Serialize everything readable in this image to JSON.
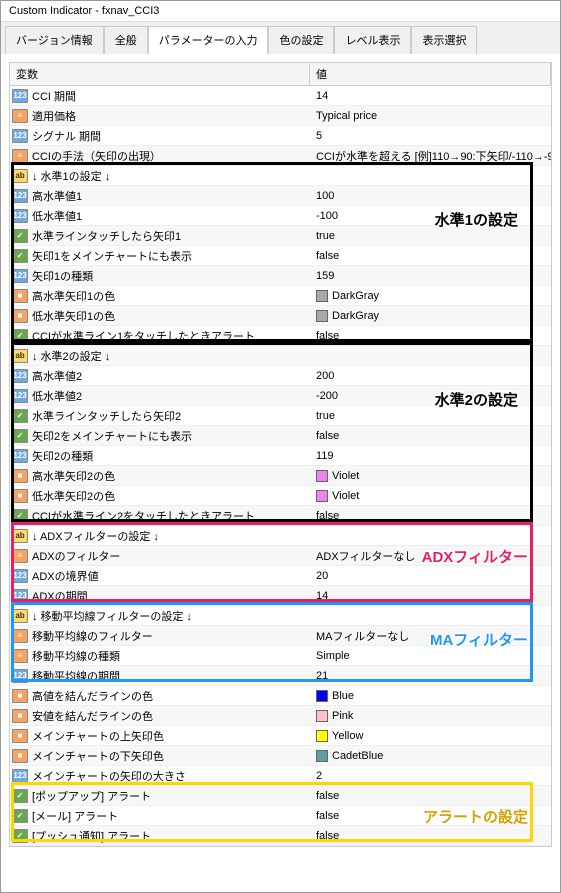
{
  "window": {
    "title": "Custom Indicator - fxnav_CCI3"
  },
  "tabs": {
    "version": "バージョン情報",
    "general": "全般",
    "params": "パラメーターの入力",
    "colors": "色の設定",
    "levels": "レベル表示",
    "display": "表示選択"
  },
  "headers": {
    "variable": "変数",
    "value": "値"
  },
  "rows": [
    {
      "icon": "int",
      "name": "CCI 期間",
      "val": "14"
    },
    {
      "icon": "enum",
      "name": "適用価格",
      "val": "Typical price"
    },
    {
      "icon": "int",
      "name": "シグナル 期間",
      "val": "5"
    },
    {
      "icon": "enum",
      "name": "CCIの手法（矢印の出現）",
      "val": "CCIが水準を超える [例]110→90:下矢印/-110→-9…"
    },
    {
      "icon": "str",
      "name": "↓ 水準1の設定 ↓",
      "val": ""
    },
    {
      "icon": "int",
      "name": "高水準値1",
      "val": "100"
    },
    {
      "icon": "int",
      "name": "低水準値1",
      "val": "-100"
    },
    {
      "icon": "bool",
      "name": "水準ラインタッチしたら矢印1",
      "val": "true"
    },
    {
      "icon": "bool",
      "name": "矢印1をメインチャートにも表示",
      "val": "false"
    },
    {
      "icon": "int",
      "name": "矢印1の種類",
      "val": "159"
    },
    {
      "icon": "color",
      "name": "高水準矢印1の色",
      "val": "DarkGray",
      "swatch": "#a9a9a9"
    },
    {
      "icon": "color",
      "name": "低水準矢印1の色",
      "val": "DarkGray",
      "swatch": "#a9a9a9"
    },
    {
      "icon": "bool",
      "name": "CCIが水準ライン1をタッチしたときアラート",
      "val": "false"
    },
    {
      "icon": "str",
      "name": "↓ 水準2の設定 ↓",
      "val": ""
    },
    {
      "icon": "int",
      "name": "高水準値2",
      "val": "200"
    },
    {
      "icon": "int",
      "name": "低水準値2",
      "val": "-200"
    },
    {
      "icon": "bool",
      "name": "水準ラインタッチしたら矢印2",
      "val": "true"
    },
    {
      "icon": "bool",
      "name": "矢印2をメインチャートにも表示",
      "val": "false"
    },
    {
      "icon": "int",
      "name": "矢印2の種類",
      "val": "119"
    },
    {
      "icon": "color",
      "name": "高水準矢印2の色",
      "val": "Violet",
      "swatch": "#ee82ee"
    },
    {
      "icon": "color",
      "name": "低水準矢印2の色",
      "val": "Violet",
      "swatch": "#ee82ee"
    },
    {
      "icon": "bool",
      "name": "CCIが水準ライン2をタッチしたときアラート",
      "val": "false"
    },
    {
      "icon": "str",
      "name": "↓ ADXフィルターの設定 ↓",
      "val": ""
    },
    {
      "icon": "enum",
      "name": "ADXのフィルター",
      "val": "ADXフィルターなし"
    },
    {
      "icon": "int",
      "name": "ADXの境界値",
      "val": "20"
    },
    {
      "icon": "int",
      "name": "ADXの期間",
      "val": "14"
    },
    {
      "icon": "str",
      "name": "↓ 移動平均線フィルターの設定 ↓",
      "val": ""
    },
    {
      "icon": "enum",
      "name": "移動平均線のフィルター",
      "val": "MAフィルターなし"
    },
    {
      "icon": "enum",
      "name": "移動平均線の種類",
      "val": "Simple"
    },
    {
      "icon": "int",
      "name": "移動平均線の期間",
      "val": "21"
    },
    {
      "icon": "color",
      "name": "高値を結んだラインの色",
      "val": "Blue",
      "swatch": "#0000ff"
    },
    {
      "icon": "color",
      "name": "安値を結んだラインの色",
      "val": "Pink",
      "swatch": "#ffc0cb"
    },
    {
      "icon": "color",
      "name": "メインチャートの上矢印色",
      "val": "Yellow",
      "swatch": "#ffff00"
    },
    {
      "icon": "color",
      "name": "メインチャートの下矢印色",
      "val": "CadetBlue",
      "swatch": "#5f9ea0"
    },
    {
      "icon": "int",
      "name": "メインチャートの矢印の大きさ",
      "val": "2"
    },
    {
      "icon": "bool",
      "name": "[ポップアップ] アラート",
      "val": "false"
    },
    {
      "icon": "bool",
      "name": "[メール] アラート",
      "val": "false"
    },
    {
      "icon": "bool",
      "name": "[プッシュ通知] アラート",
      "val": "false"
    }
  ],
  "overlays": {
    "level1": "水準1の設定",
    "level2": "水準2の設定",
    "adx": "ADXフィルター",
    "ma": "MAフィルター",
    "alert": "アラートの設定"
  }
}
